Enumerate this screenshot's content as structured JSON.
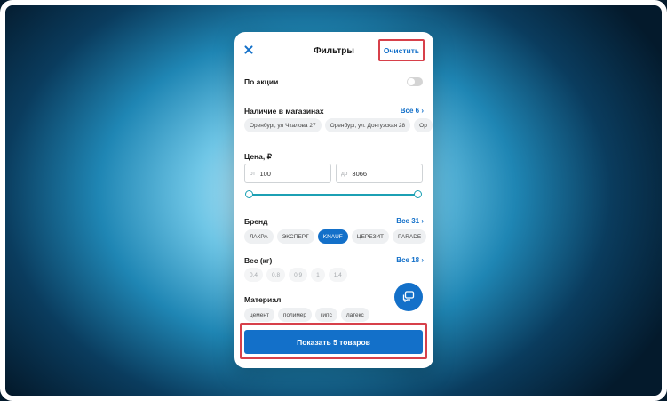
{
  "header": {
    "title": "Фильтры",
    "clear_label": "Очистить"
  },
  "promo": {
    "label": "По акции",
    "toggle_on": false
  },
  "stores": {
    "label": "Наличие в магазинах",
    "see_all": "Все 6",
    "chips": [
      "Оренбург, ул Чкалова 27",
      "Оренбург, ул. Донгузская 28",
      "Ор"
    ]
  },
  "price": {
    "label": "Цена, ₽",
    "from_prefix": "от",
    "from_value": "100",
    "to_prefix": "до",
    "to_value": "3066"
  },
  "brand": {
    "label": "Бренд",
    "see_all": "Все 31",
    "chips": [
      "ЛАКРА",
      "ЭКСПЕРТ",
      "KNAUF",
      "ЦЕРЕЗИТ",
      "PARADE"
    ],
    "selected": "KNAUF"
  },
  "weight": {
    "label": "Вес (кг)",
    "see_all": "Все 18",
    "chips": [
      "0.4",
      "0.8",
      "0.9",
      "1",
      "1.4"
    ]
  },
  "material": {
    "label": "Материал",
    "chips": [
      "цемент",
      "полимер",
      "гипс",
      "латекс"
    ]
  },
  "footer": {
    "show_label": "Показать 5 товаров"
  },
  "icons": {
    "close": "close-icon",
    "chevron": "chevron-right-icon",
    "chat": "chat-icon"
  },
  "colors": {
    "accent": "#1370c9",
    "highlight_outline": "#d7404a",
    "slider": "#1ca0b4"
  }
}
